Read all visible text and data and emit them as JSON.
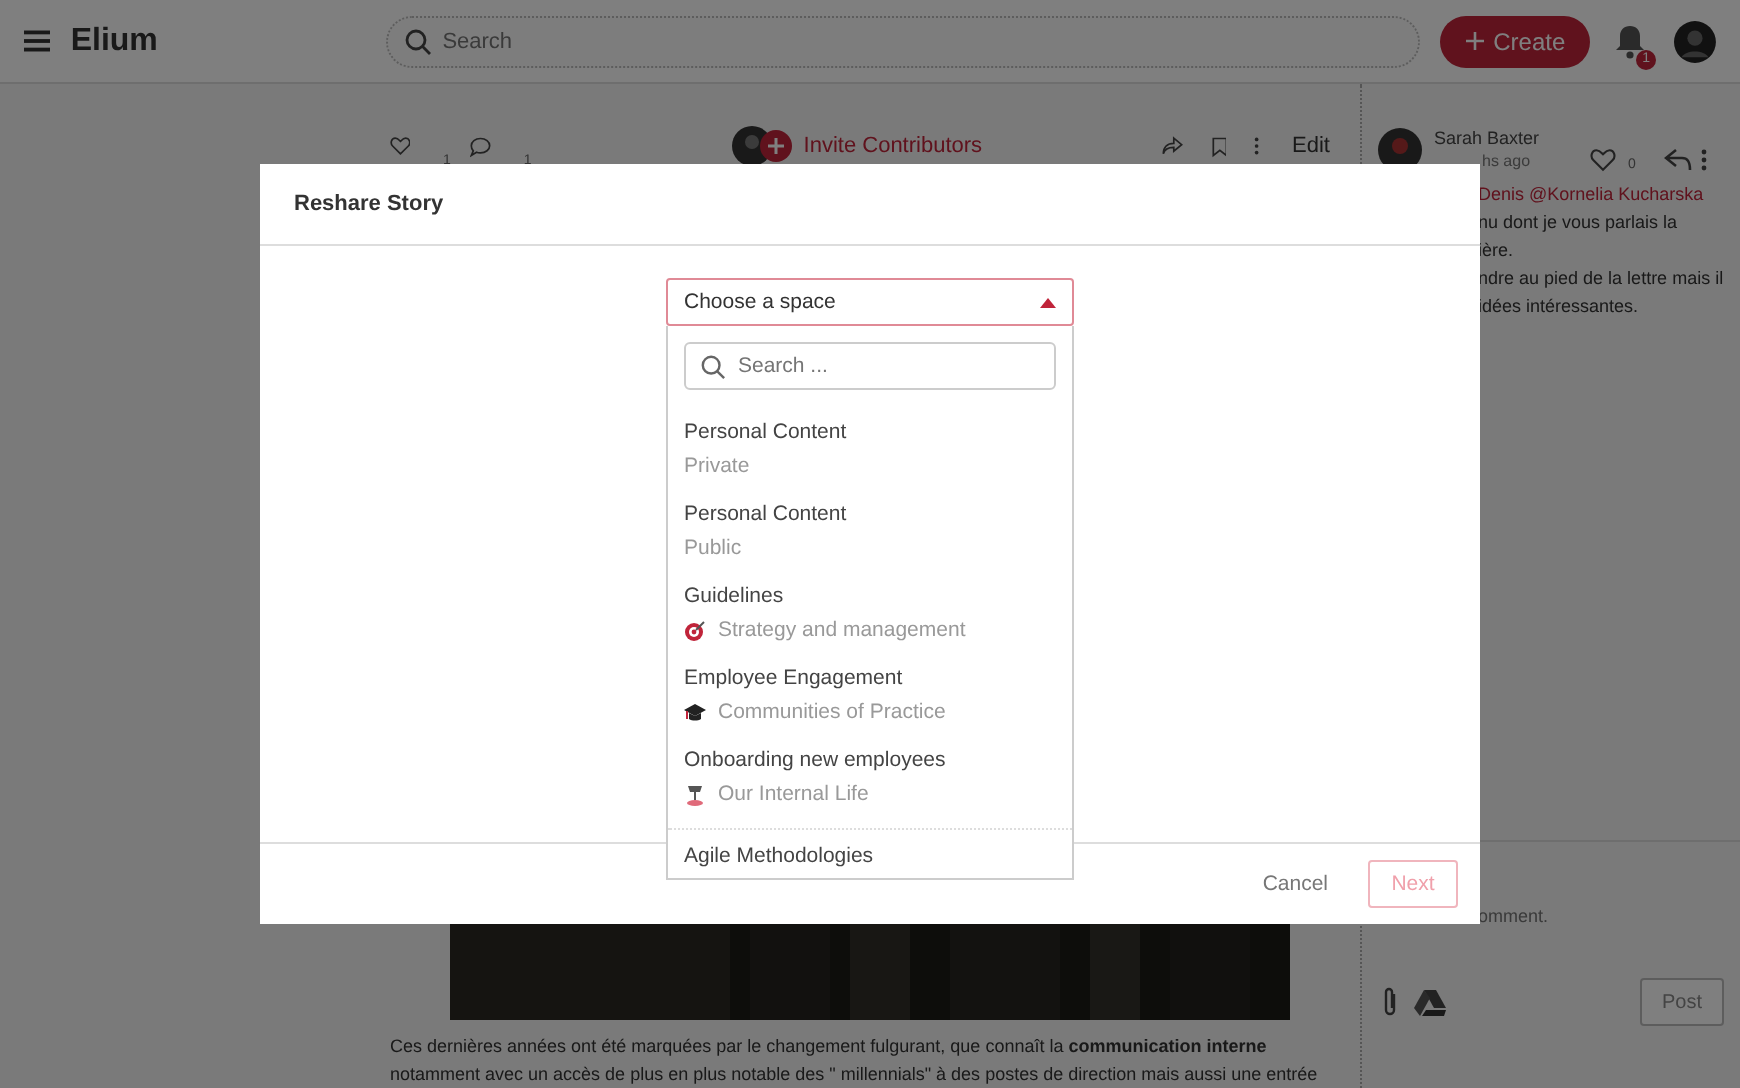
{
  "topbar": {
    "app_name": "Elium",
    "search": {
      "placeholder": "Search"
    },
    "create_button": "Create",
    "notification_count": "1"
  },
  "article_toolbar": {
    "likes": "1",
    "comments": "1",
    "invite": "Invite Contributors",
    "edit": "Edit"
  },
  "article": {
    "paragraph": "Ces dernières années ont été marquées par le changement fulgurant, que connaît la **communication interne** notamment avec un accès de plus en plus notable des \" millennials\" à des postes de direction mais aussi une entrée"
  },
  "comment_panel": {
    "author": "Sarah Baxter",
    "time": "hs ago",
    "likes": "0",
    "lines": [
      {
        "text": "Denis @Kornelia Kucharska",
        "kind": "mention"
      },
      {
        "text": "nu dont je vous parlais la",
        "kind": "text"
      },
      {
        "text": "ière.",
        "kind": "text"
      },
      {
        "text": "ndre au pied de la lettre mais il",
        "kind": "text"
      },
      {
        "text": "idées intéressantes.",
        "kind": "text"
      }
    ],
    "comment_field": {
      "placeholder": "omment."
    },
    "post_button": "Post"
  },
  "dialog": {
    "title": "Reshare Story",
    "select": {
      "placeholder": "Choose a space",
      "expanded": true
    },
    "search": {
      "placeholder": "Search ..."
    },
    "spaces": [
      {
        "name": "Personal Content",
        "detail": "Private",
        "kind": "plain"
      },
      {
        "name": "Personal Content",
        "detail": "Public",
        "kind": "plain"
      },
      {
        "name": "Guidelines",
        "detail": "Strategy and management",
        "kind": "target"
      },
      {
        "name": "Employee Engagement",
        "detail": "Communities of Practice",
        "kind": "cap"
      },
      {
        "name": "Onboarding new employees",
        "detail": "Our Internal Life",
        "kind": "lamp"
      },
      {
        "name": "Agile Methodologies"
      }
    ],
    "cancel_button": "Cancel",
    "next_button": {
      "label": "Next",
      "disabled": true
    }
  }
}
